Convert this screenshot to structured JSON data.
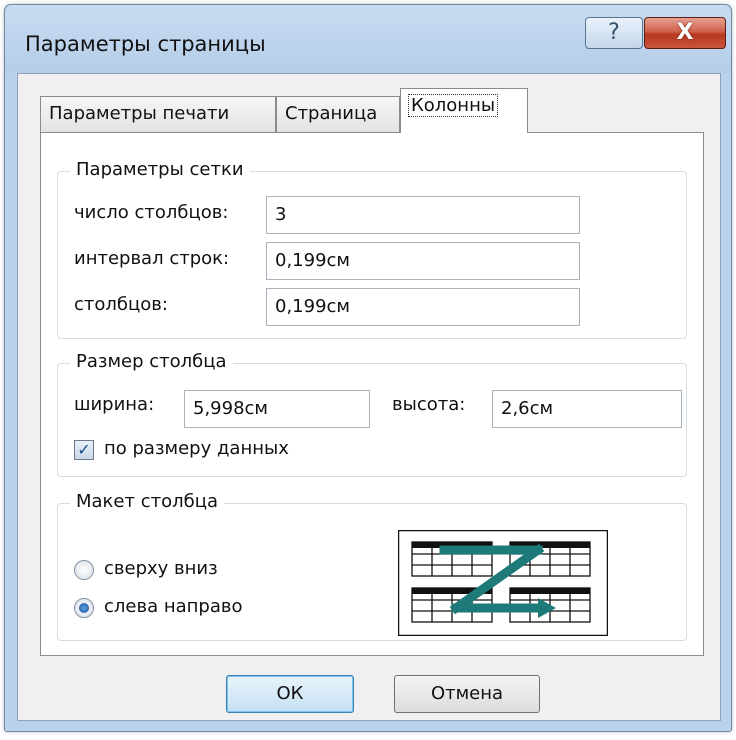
{
  "window": {
    "title": "Параметры страницы",
    "help_glyph": "?",
    "close_glyph": "X"
  },
  "tabs": [
    {
      "label": "Параметры печати",
      "active": false
    },
    {
      "label": "Страница",
      "active": false
    },
    {
      "label": "Колонны",
      "active": true
    }
  ],
  "grid": {
    "legend": "Параметры сетки",
    "columns_label": "число столбцов:",
    "columns_value": "3",
    "row_spacing_label": "интервал строк:",
    "row_spacing_value": "0,199см",
    "col_spacing_label": "столбцов:",
    "col_spacing_value": "0,199см"
  },
  "size": {
    "legend": "Размер столбца",
    "width_label": "ширина:",
    "width_value": "5,998см",
    "height_label": "высота:",
    "height_value": "2,6см",
    "fit_label": "по размеру данных",
    "fit_checked": true
  },
  "layout": {
    "legend": "Макет столбца",
    "option_top_down": "сверху вниз",
    "option_left_right": "слева направо",
    "selected": "слева направо"
  },
  "buttons": {
    "ok": "ОК",
    "cancel": "Отмена"
  },
  "colors": {
    "title_bar": "#b9d1ea",
    "close": "#c9553d",
    "accent_arrow": "#1d7a78"
  }
}
